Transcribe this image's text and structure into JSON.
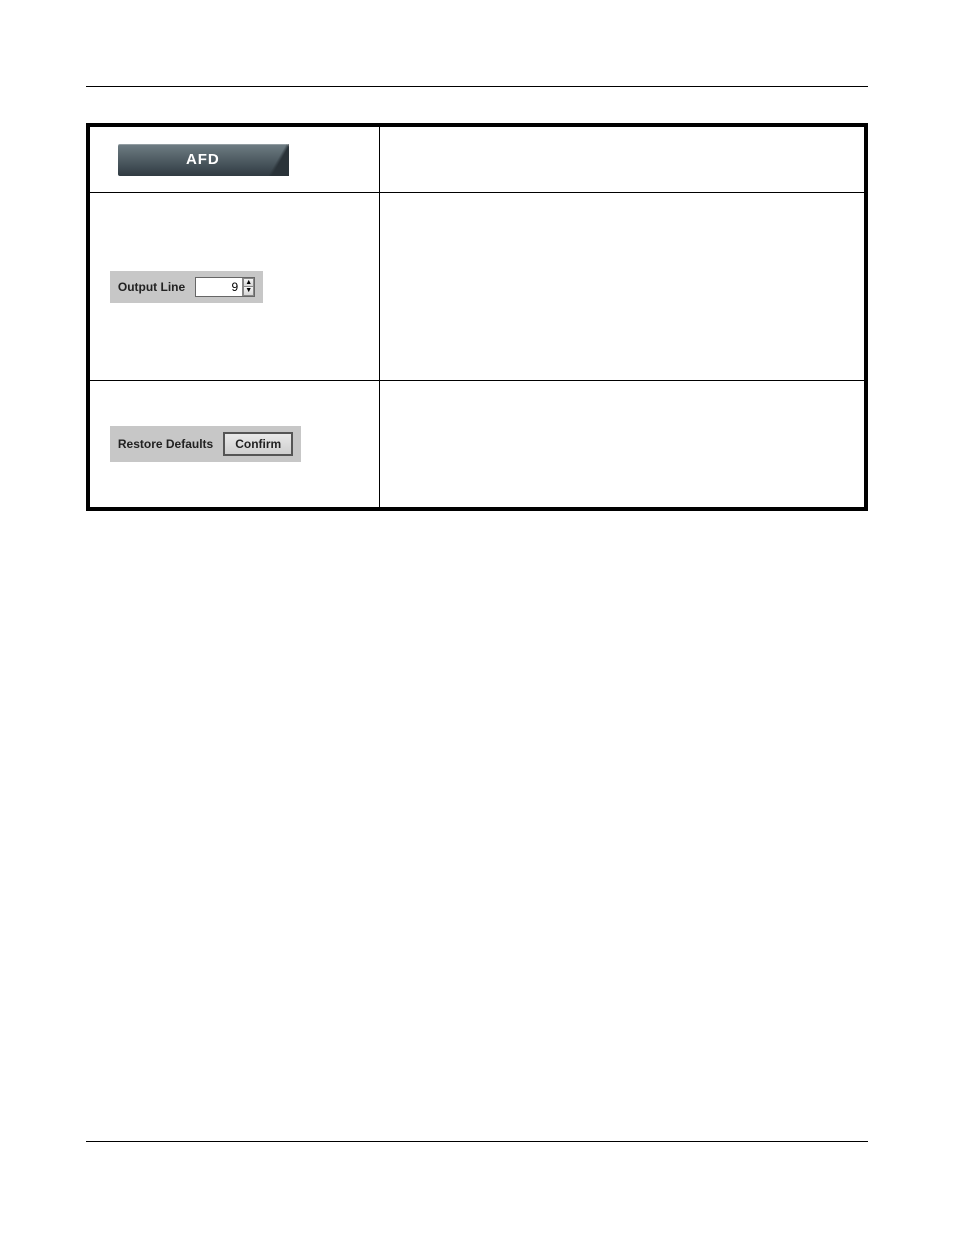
{
  "afd": {
    "tab_label": "AFD",
    "output_line": {
      "label": "Output Line",
      "value": "9"
    },
    "restore": {
      "label": "Restore Defaults",
      "button": "Confirm"
    }
  }
}
